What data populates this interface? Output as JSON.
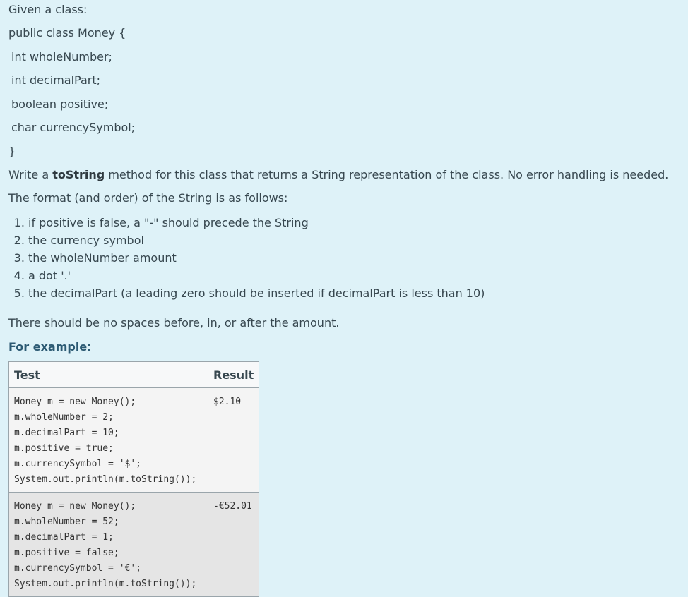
{
  "intro": "Given a class:",
  "class_code": {
    "decl": "public class Money {",
    "fields": [
      "int wholeNumber;",
      "int decimalPart;",
      "boolean positive;",
      "char currencySymbol;"
    ],
    "close": "}"
  },
  "task": {
    "pre": "Write a ",
    "method": "toString",
    "post": " method for this class that returns a String representation of the class. No error handling is needed."
  },
  "format_intro": "The format (and order) of the String is as follows:",
  "steps": [
    "if positive is false, a \"-\" should precede the String",
    "the currency symbol",
    "the wholeNumber amount",
    "a dot '.'",
    "the decimalPart (a leading zero should be inserted if decimalPart is less than 10)"
  ],
  "no_spaces": "There should be no spaces before, in, or after the amount.",
  "for_example": "For example:",
  "table": {
    "headers": [
      "Test",
      "Result"
    ],
    "rows": [
      {
        "test": "Money m = new Money();\nm.wholeNumber = 2;\nm.decimalPart = 10;\nm.positive = true;\nm.currencySymbol = '$';\nSystem.out.println(m.toString());",
        "result": "$2.10"
      },
      {
        "test": "Money m = new Money();\nm.wholeNumber = 52;\nm.decimalPart = 1;\nm.positive = false;\nm.currencySymbol = '€';\nSystem.out.println(m.toString());",
        "result": "-€52.01"
      }
    ]
  }
}
